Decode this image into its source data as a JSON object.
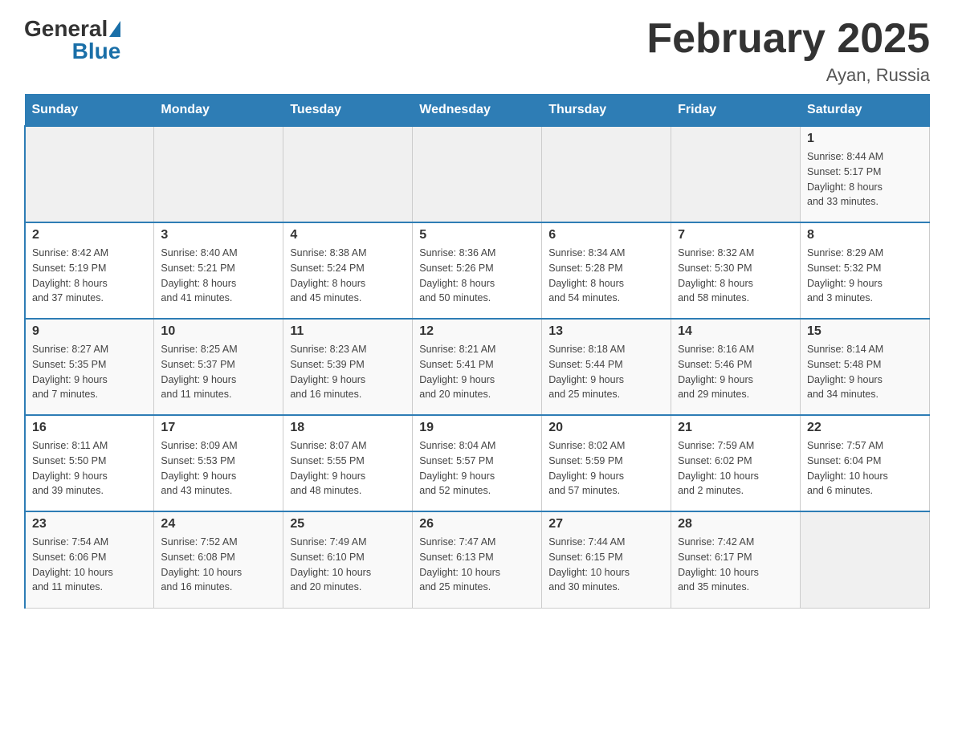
{
  "header": {
    "logo": {
      "general": "General",
      "blue": "Blue"
    },
    "title": "February 2025",
    "location": "Ayan, Russia"
  },
  "weekdays": [
    "Sunday",
    "Monday",
    "Tuesday",
    "Wednesday",
    "Thursday",
    "Friday",
    "Saturday"
  ],
  "weeks": [
    [
      {
        "day": "",
        "info": ""
      },
      {
        "day": "",
        "info": ""
      },
      {
        "day": "",
        "info": ""
      },
      {
        "day": "",
        "info": ""
      },
      {
        "day": "",
        "info": ""
      },
      {
        "day": "",
        "info": ""
      },
      {
        "day": "1",
        "info": "Sunrise: 8:44 AM\nSunset: 5:17 PM\nDaylight: 8 hours\nand 33 minutes."
      }
    ],
    [
      {
        "day": "2",
        "info": "Sunrise: 8:42 AM\nSunset: 5:19 PM\nDaylight: 8 hours\nand 37 minutes."
      },
      {
        "day": "3",
        "info": "Sunrise: 8:40 AM\nSunset: 5:21 PM\nDaylight: 8 hours\nand 41 minutes."
      },
      {
        "day": "4",
        "info": "Sunrise: 8:38 AM\nSunset: 5:24 PM\nDaylight: 8 hours\nand 45 minutes."
      },
      {
        "day": "5",
        "info": "Sunrise: 8:36 AM\nSunset: 5:26 PM\nDaylight: 8 hours\nand 50 minutes."
      },
      {
        "day": "6",
        "info": "Sunrise: 8:34 AM\nSunset: 5:28 PM\nDaylight: 8 hours\nand 54 minutes."
      },
      {
        "day": "7",
        "info": "Sunrise: 8:32 AM\nSunset: 5:30 PM\nDaylight: 8 hours\nand 58 minutes."
      },
      {
        "day": "8",
        "info": "Sunrise: 8:29 AM\nSunset: 5:32 PM\nDaylight: 9 hours\nand 3 minutes."
      }
    ],
    [
      {
        "day": "9",
        "info": "Sunrise: 8:27 AM\nSunset: 5:35 PM\nDaylight: 9 hours\nand 7 minutes."
      },
      {
        "day": "10",
        "info": "Sunrise: 8:25 AM\nSunset: 5:37 PM\nDaylight: 9 hours\nand 11 minutes."
      },
      {
        "day": "11",
        "info": "Sunrise: 8:23 AM\nSunset: 5:39 PM\nDaylight: 9 hours\nand 16 minutes."
      },
      {
        "day": "12",
        "info": "Sunrise: 8:21 AM\nSunset: 5:41 PM\nDaylight: 9 hours\nand 20 minutes."
      },
      {
        "day": "13",
        "info": "Sunrise: 8:18 AM\nSunset: 5:44 PM\nDaylight: 9 hours\nand 25 minutes."
      },
      {
        "day": "14",
        "info": "Sunrise: 8:16 AM\nSunset: 5:46 PM\nDaylight: 9 hours\nand 29 minutes."
      },
      {
        "day": "15",
        "info": "Sunrise: 8:14 AM\nSunset: 5:48 PM\nDaylight: 9 hours\nand 34 minutes."
      }
    ],
    [
      {
        "day": "16",
        "info": "Sunrise: 8:11 AM\nSunset: 5:50 PM\nDaylight: 9 hours\nand 39 minutes."
      },
      {
        "day": "17",
        "info": "Sunrise: 8:09 AM\nSunset: 5:53 PM\nDaylight: 9 hours\nand 43 minutes."
      },
      {
        "day": "18",
        "info": "Sunrise: 8:07 AM\nSunset: 5:55 PM\nDaylight: 9 hours\nand 48 minutes."
      },
      {
        "day": "19",
        "info": "Sunrise: 8:04 AM\nSunset: 5:57 PM\nDaylight: 9 hours\nand 52 minutes."
      },
      {
        "day": "20",
        "info": "Sunrise: 8:02 AM\nSunset: 5:59 PM\nDaylight: 9 hours\nand 57 minutes."
      },
      {
        "day": "21",
        "info": "Sunrise: 7:59 AM\nSunset: 6:02 PM\nDaylight: 10 hours\nand 2 minutes."
      },
      {
        "day": "22",
        "info": "Sunrise: 7:57 AM\nSunset: 6:04 PM\nDaylight: 10 hours\nand 6 minutes."
      }
    ],
    [
      {
        "day": "23",
        "info": "Sunrise: 7:54 AM\nSunset: 6:06 PM\nDaylight: 10 hours\nand 11 minutes."
      },
      {
        "day": "24",
        "info": "Sunrise: 7:52 AM\nSunset: 6:08 PM\nDaylight: 10 hours\nand 16 minutes."
      },
      {
        "day": "25",
        "info": "Sunrise: 7:49 AM\nSunset: 6:10 PM\nDaylight: 10 hours\nand 20 minutes."
      },
      {
        "day": "26",
        "info": "Sunrise: 7:47 AM\nSunset: 6:13 PM\nDaylight: 10 hours\nand 25 minutes."
      },
      {
        "day": "27",
        "info": "Sunrise: 7:44 AM\nSunset: 6:15 PM\nDaylight: 10 hours\nand 30 minutes."
      },
      {
        "day": "28",
        "info": "Sunrise: 7:42 AM\nSunset: 6:17 PM\nDaylight: 10 hours\nand 35 minutes."
      },
      {
        "day": "",
        "info": ""
      }
    ]
  ]
}
